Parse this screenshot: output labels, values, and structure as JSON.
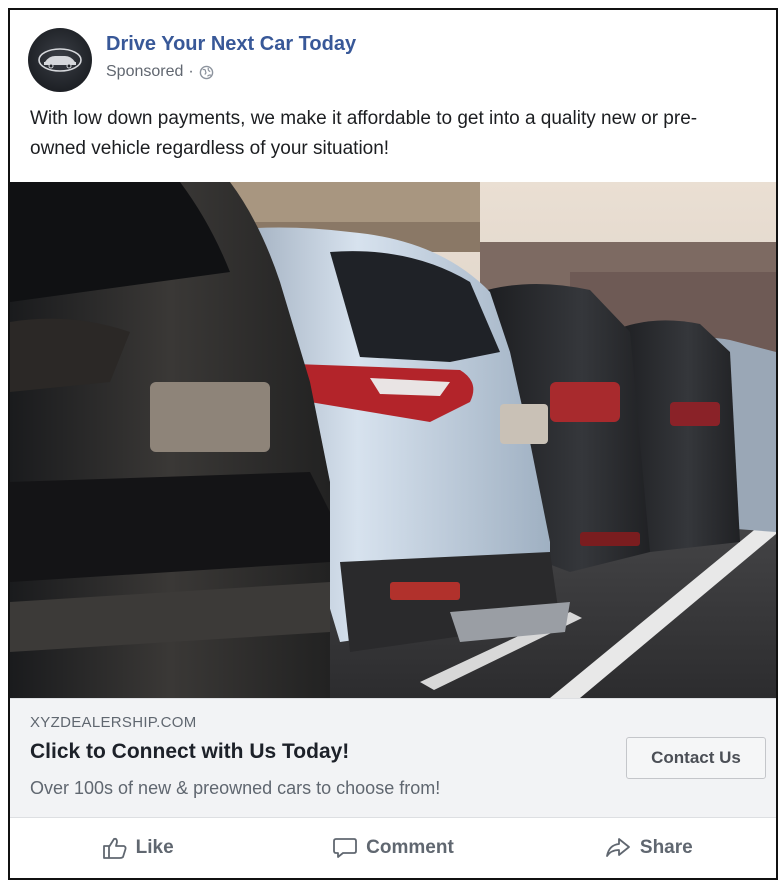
{
  "post": {
    "page_name": "Drive Your Next Car Today",
    "sponsored_label": "Sponsored",
    "separator": "·",
    "audience_icon": "globe-icon",
    "body_text": "With low down payments, we make it affordable to get into a quality new or pre-owned vehicle regardless of your situation!"
  },
  "link_preview": {
    "domain": "XYZDEALERSHIP.COM",
    "headline": "Click to Connect with Us Today!",
    "description": "Over 100s of new & preowned cars to choose from!",
    "cta_label": "Contact Us"
  },
  "actions": [
    {
      "label": "Like",
      "icon": "thumbs-up-icon"
    },
    {
      "label": "Comment",
      "icon": "comment-bubble-icon"
    },
    {
      "label": "Share",
      "icon": "share-arrow-icon"
    }
  ],
  "colors": {
    "page_name": "#385898",
    "meta_text": "#616770",
    "link_box_bg": "#f2f3f5"
  }
}
